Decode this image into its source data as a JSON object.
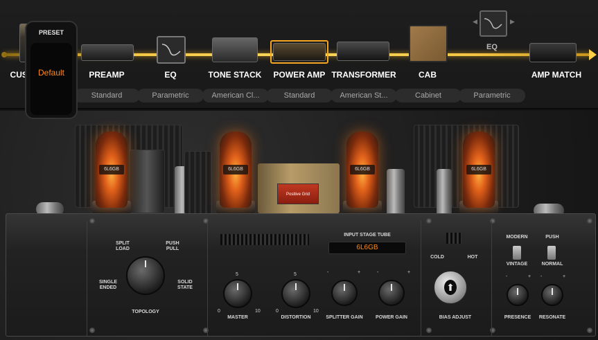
{
  "chain": {
    "modules": [
      {
        "label": "CUSTOM PANEL",
        "sub": ""
      },
      {
        "label": "PREAMP",
        "sub": "Standard"
      },
      {
        "label": "EQ",
        "sub": "Parametric"
      },
      {
        "label": "TONE STACK",
        "sub": "American Cl..."
      },
      {
        "label": "POWER AMP",
        "sub": "Standard"
      },
      {
        "label": "TRANSFORMER",
        "sub": "American St..."
      },
      {
        "label": "CAB",
        "sub": "Cabinet"
      },
      {
        "label": "EQ",
        "sub": "Parametric"
      },
      {
        "label": "AMP MATCH",
        "sub": ""
      }
    ],
    "selected": "POWER AMP",
    "accent": "#f5a623"
  },
  "amp": {
    "tube_label": "6L6GB",
    "plate_label": "Positive Grid"
  },
  "panel": {
    "preset": {
      "title": "PRESET",
      "value": "Default"
    },
    "topology": {
      "label": "TOPOLOGY",
      "opt_split": "SPLIT\nLOAD",
      "opt_push": "PUSH\nPULL",
      "opt_single": "SINGLE\nENDED",
      "opt_solid": "SOLID\nSTATE"
    },
    "input_stage": {
      "title": "INPUT STAGE TUBE",
      "value": "6L6GB"
    },
    "knobs": {
      "master": "MASTER",
      "distortion": "DISTORTION",
      "splitter_gain": "SPLITTER GAIN",
      "power_gain": "POWER GAIN",
      "scale_min": "0",
      "scale_mid": "5",
      "scale_max": "10",
      "minus": "-",
      "plus": "+"
    },
    "bias": {
      "cold": "COLD",
      "hot": "HOT",
      "label": "BIAS ADJUST"
    },
    "switches": {
      "modern": "MODERN",
      "vintage": "VINTAGE",
      "push": "PUSH",
      "normal": "NORMAL"
    },
    "right_knobs": {
      "presence": "PRESENCE",
      "resonate": "RESONATE"
    },
    "accent": "#ff8a1e"
  }
}
